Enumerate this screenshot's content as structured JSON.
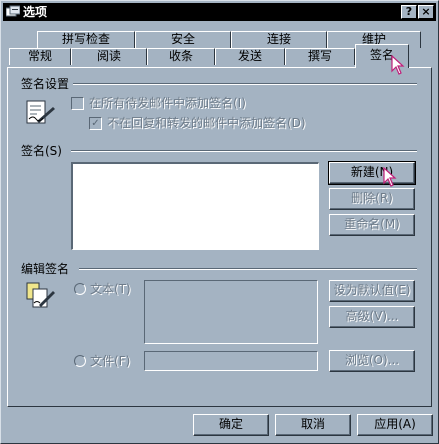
{
  "window": {
    "title": "选项",
    "help_label": "?",
    "close_label": "×"
  },
  "tabs_back": [
    {
      "label": "拼写检查"
    },
    {
      "label": "安全"
    },
    {
      "label": "连接"
    },
    {
      "label": "维护"
    }
  ],
  "tabs_front": [
    {
      "label": "常规"
    },
    {
      "label": "阅读"
    },
    {
      "label": "收条"
    },
    {
      "label": "发送"
    },
    {
      "label": "撰写"
    },
    {
      "label": "签名"
    }
  ],
  "signature_settings": {
    "heading": "签名设置",
    "add_to_all": {
      "label": "在所有待发邮件中添加签名(I)",
      "checked": false
    },
    "no_reply_forward": {
      "label": "不在回复和转发的邮件中添加签名(D)",
      "checked": true
    }
  },
  "signatures": {
    "heading": "签名(S)",
    "items": [],
    "new_button": "新建(N)",
    "delete_button": "删除(R)",
    "rename_button": "重命名(M)"
  },
  "edit_signature": {
    "heading": "编辑签名",
    "text_option": "文本(T)",
    "file_option": "文件(F)",
    "set_default_button": "设为默认值(E)",
    "advanced_button": "高级(V)...",
    "browse_button": "浏览(O)..."
  },
  "footer": {
    "ok_button": "确定",
    "cancel_button": "取消",
    "apply_button": "应用(A)"
  },
  "colors": {
    "face": "#a4b3c2",
    "shadow": "#5a6876",
    "highlight": "#ffffff",
    "titlebar": "#000000"
  }
}
